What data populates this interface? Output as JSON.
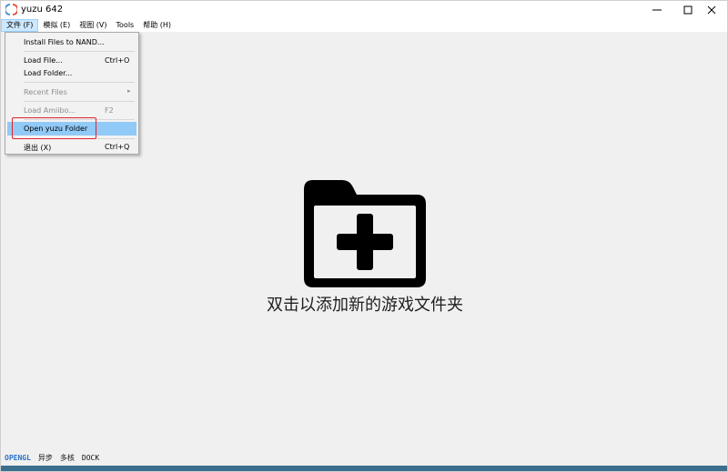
{
  "window": {
    "title": "yuzu 642"
  },
  "menubar": {
    "items": [
      {
        "label": "文件 (F)",
        "active": true
      },
      {
        "label": "模拟 (E)"
      },
      {
        "label": "视图 (V)"
      },
      {
        "label": "Tools"
      },
      {
        "label": "帮助 (H)"
      }
    ]
  },
  "file_menu": {
    "install_nand": "Install Files to NAND...",
    "load_file": "Load File...",
    "load_file_shortcut": "Ctrl+O",
    "load_folder": "Load Folder...",
    "recent_files": "Recent Files",
    "load_amiibo": "Load Amiibo...",
    "load_amiibo_shortcut": "F2",
    "open_yuzu_folder": "Open yuzu Folder",
    "exit": "退出 (X)",
    "exit_shortcut": "Ctrl+Q"
  },
  "main": {
    "placeholder_text": "双击以添加新的游戏文件夹"
  },
  "statusbar": {
    "renderer": "OPENGL",
    "async": "异步",
    "multicore": "多核",
    "dock": "DOCK"
  },
  "colors": {
    "highlight": "#91c9f7",
    "annotation_box": "#e0242b",
    "renderer_accent": "#2d72c8",
    "bottom_bar": "#3c6e8f"
  }
}
